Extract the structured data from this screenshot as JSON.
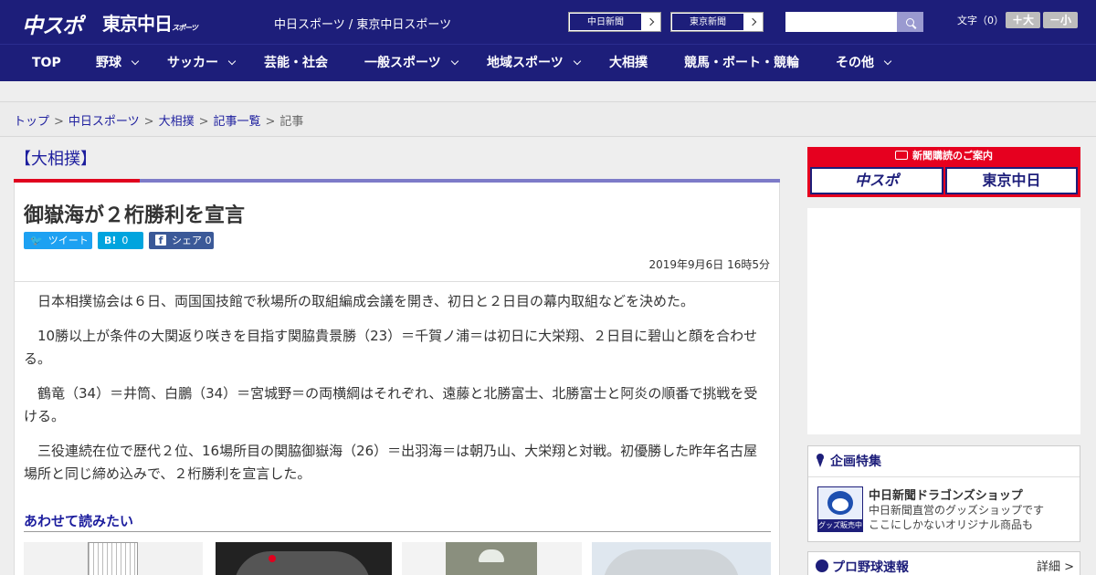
{
  "header": {
    "logo_chuspo": "中スポ",
    "logo_tokyo": "東京中日",
    "logo_tokyo_sub": "スポーツ",
    "site_title": "中日スポーツ / 東京中日スポーツ",
    "paper_links": [
      "中日新聞",
      "東京新聞"
    ],
    "search_placeholder": "",
    "font_size_label": "文字（0）",
    "font_larger": "＋大",
    "font_smaller": "－小"
  },
  "nav": {
    "items": [
      {
        "label": "TOP",
        "dropdown": false
      },
      {
        "label": "野球",
        "dropdown": true
      },
      {
        "label": "サッカー",
        "dropdown": true
      },
      {
        "label": "芸能・社会",
        "dropdown": false
      },
      {
        "label": "一般スポーツ",
        "dropdown": true
      },
      {
        "label": "地域スポーツ",
        "dropdown": true
      },
      {
        "label": "大相撲",
        "dropdown": false
      },
      {
        "label": "競馬・ボート・競輪",
        "dropdown": false
      },
      {
        "label": "その他",
        "dropdown": true
      }
    ]
  },
  "breadcrumb": {
    "items": [
      "トップ",
      "中日スポーツ",
      "大相撲",
      "記事一覧"
    ],
    "current": "記事",
    "separator": ">"
  },
  "article": {
    "category": "【大相撲】",
    "title": "御嶽海が２桁勝利を宣言",
    "share": {
      "tweet": "ツイート",
      "hatena_icon": "B!",
      "hatena_count": "0",
      "facebook": "シェア",
      "facebook_count": "0"
    },
    "date": "2019年9月6日 16時5分",
    "paragraphs": [
      "日本相撲協会は６日、両国国技館で秋場所の取組編成会議を開き、初日と２日目の幕内取組などを決めた。",
      "10勝以上が条件の大関返り咲きを目指す関脇貴景勝（23）＝千賀ノ浦＝は初日に大栄翔、２日目に碧山と顔を合わせる。",
      "鶴竜（34）＝井筒、白鵬（34）＝宮城野＝の両横綱はそれぞれ、遠藤と北勝富士、北勝富士と阿炎の順番で挑戦を受ける。",
      "三役連続在位で歴代２位、16場所目の関脇御嶽海（26）＝出羽海＝は朝乃山、大栄翔と対戦。初優勝した昨年名古屋場所と同じ締め込みで、２桁勝利を宣言した。"
    ],
    "related_heading": "あわせて読みたい"
  },
  "sidebar": {
    "subscribe_title": "新聞購読のご案内",
    "subscribe_chuspo": "中スポ",
    "subscribe_tokyo": "東京中日",
    "special_heading": "企画特集",
    "shop_title": "中日新聞ドラゴンズショップ",
    "shop_desc_1": "中日新聞直営のグッズショップです",
    "shop_desc_2": "ここにしかないオリジナル商品も",
    "shop_badge": "グッズ販売中",
    "baseball_heading": "プロ野球速報",
    "baseball_more": "詳細 >"
  },
  "colors": {
    "header_bg": "#1d1e7a",
    "accent_red": "#e0001e",
    "link": "#1d1e9e",
    "twitter": "#1da1f2",
    "facebook": "#3b5998"
  }
}
